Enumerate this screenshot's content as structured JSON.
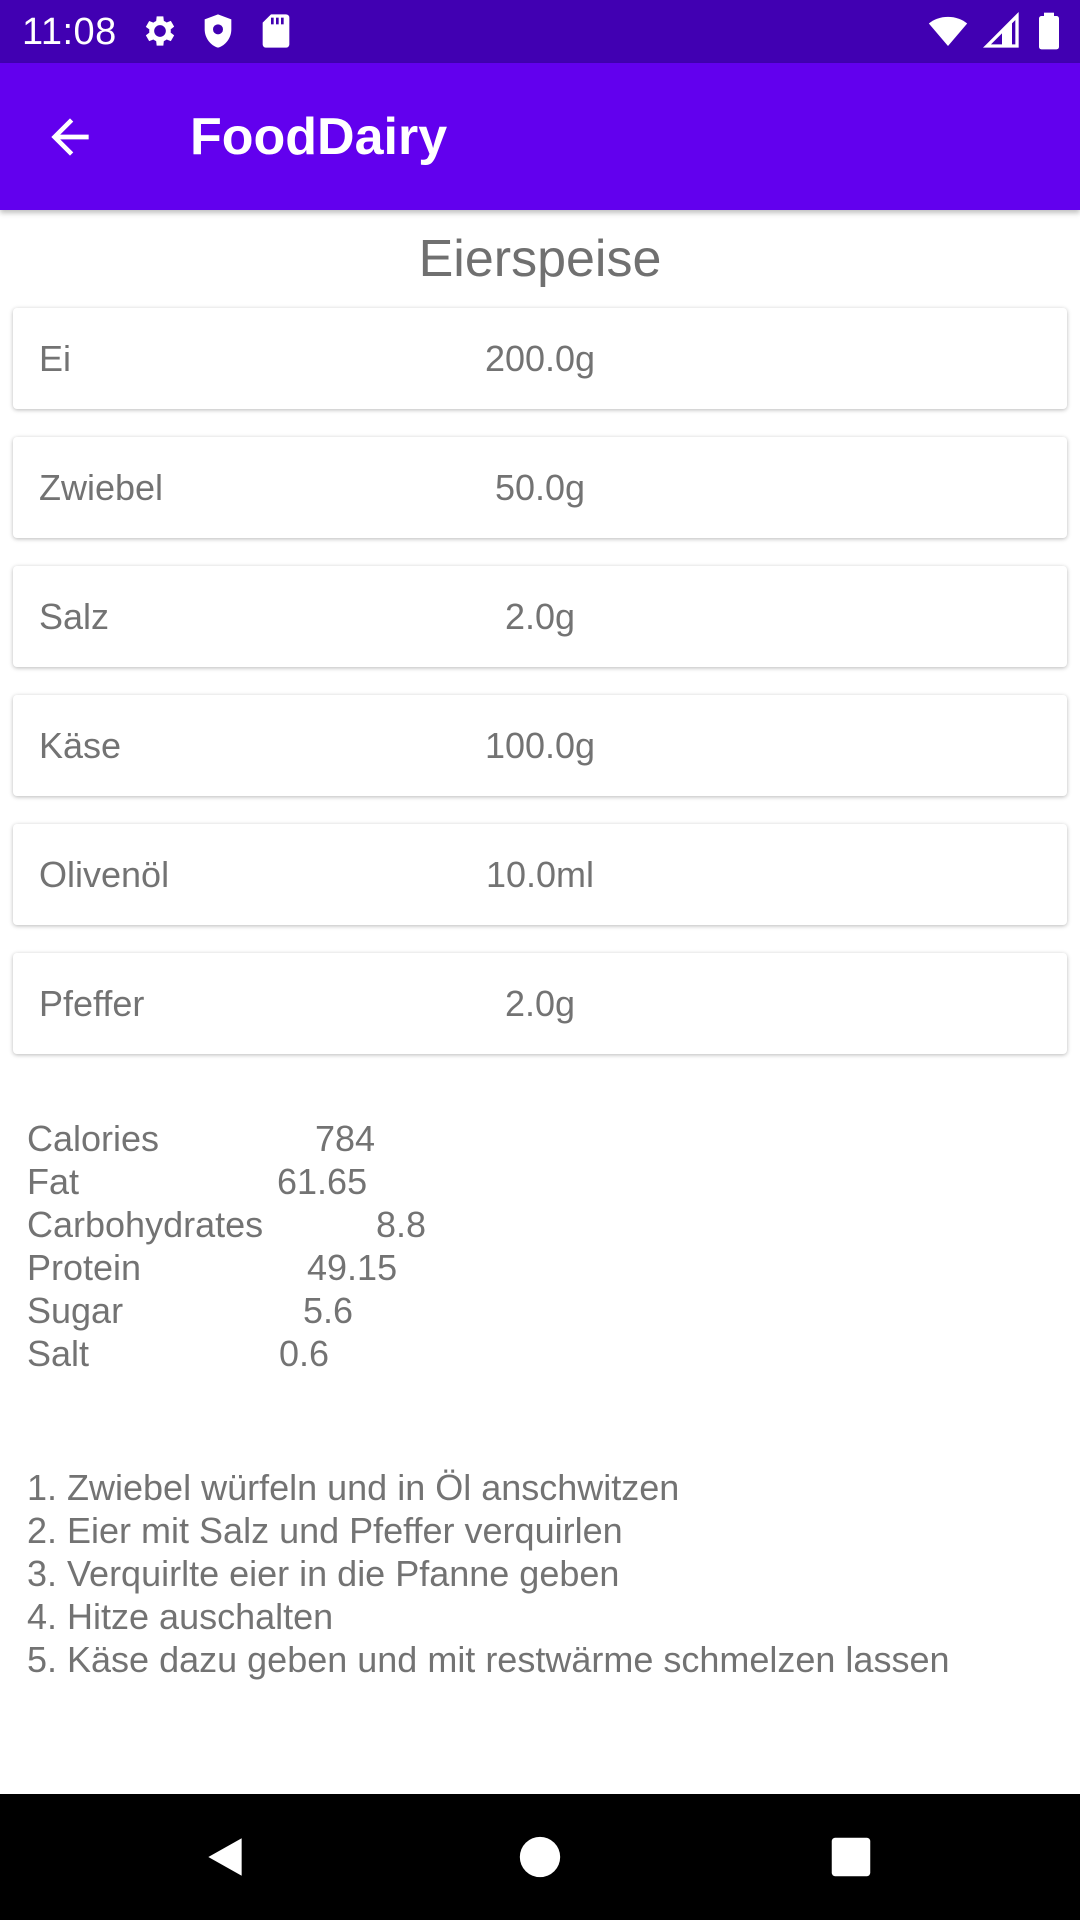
{
  "status_bar": {
    "time": "11:08",
    "left_icons": [
      "gear-icon",
      "shield-icon",
      "sd-card-icon"
    ],
    "right_icons": [
      "wifi-icon",
      "signal-icon",
      "battery-icon"
    ],
    "background": "#4100b2"
  },
  "app_bar": {
    "title": "FoodDairy",
    "back_icon": "arrow-back-icon",
    "background": "#6200ee"
  },
  "recipe": {
    "title": "Eierspeise",
    "ingredients": [
      {
        "name": "Ei",
        "amount": "200.0g"
      },
      {
        "name": "Zwiebel",
        "amount": "50.0g"
      },
      {
        "name": "Salz",
        "amount": "2.0g"
      },
      {
        "name": "Käse",
        "amount": "100.0g"
      },
      {
        "name": "Olivenöl",
        "amount": "10.0ml"
      },
      {
        "name": "Pfeffer",
        "amount": "2.0g"
      }
    ],
    "nutrition": [
      {
        "label": "Calories",
        "value": "784"
      },
      {
        "label": "Fat",
        "value": "61.65"
      },
      {
        "label": "Carbohydrates",
        "value": "8.8"
      },
      {
        "label": "Protein",
        "value": "49.15"
      },
      {
        "label": "Sugar",
        "value": "5.6"
      },
      {
        "label": "Salt",
        "value": "0.6"
      }
    ],
    "steps": [
      "1. Zwiebel würfeln und in Öl anschwitzen",
      "2. Eier mit Salz und Pfeffer verquirlen",
      "3. Verquirlte eier in die Pfanne geben",
      "4. Hitze auschalten",
      "5. Käse dazu geben und mit restwärme schmelzen lassen"
    ]
  },
  "nav_bar": {
    "icons": [
      "back-triangle-icon",
      "home-circle-icon",
      "recents-square-icon"
    ]
  }
}
